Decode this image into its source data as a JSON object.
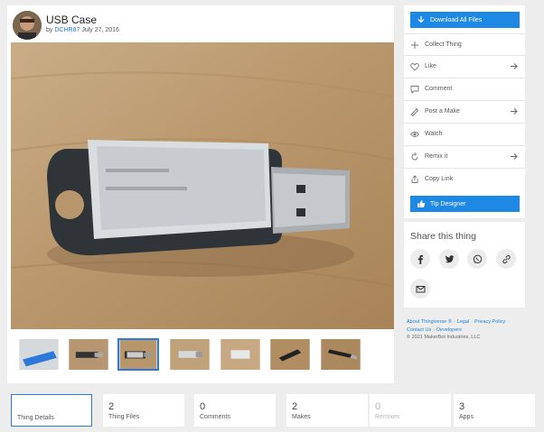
{
  "thing": {
    "title": "USB Case",
    "by": "by",
    "author": "DCHR87",
    "date": "July 27, 2016"
  },
  "actions": {
    "download": "Download All Files",
    "items": [
      {
        "label": "Collect Thing",
        "icon": "plus-icon",
        "arrow": false
      },
      {
        "label": "Like",
        "icon": "heart-icon",
        "arrow": true
      },
      {
        "label": "Comment",
        "icon": "comment-icon",
        "arrow": false
      },
      {
        "label": "Post a Make",
        "icon": "make-icon",
        "arrow": true
      },
      {
        "label": "Watch",
        "icon": "eye-icon",
        "arrow": false
      },
      {
        "label": "Remix it",
        "icon": "remix-icon",
        "arrow": true
      },
      {
        "label": "Copy Link",
        "icon": "link-copy-icon",
        "arrow": false
      }
    ],
    "tip": "Tip Designer"
  },
  "share": {
    "title": "Share this thing",
    "buttons": [
      "facebook-icon",
      "twitter-icon",
      "whatsapp-icon",
      "link-icon",
      "email-icon"
    ]
  },
  "footer": {
    "about": "About Thingiverse ®",
    "legal": "Legal",
    "privacy": "Privacy Policy",
    "contact": "Contact Us",
    "developers": "Developers",
    "copyright": "© 2021 MakerBot Industries, LLC"
  },
  "tabs": [
    {
      "num": "",
      "label": "Thing Details",
      "active": true,
      "disabled": false
    },
    {
      "num": "2",
      "label": "Thing Files",
      "active": false,
      "disabled": false
    },
    {
      "num": "0",
      "label": "Comments",
      "active": false,
      "disabled": false
    },
    {
      "num": "2",
      "label": "Makes",
      "active": false,
      "disabled": false
    },
    {
      "num": "0",
      "label": "Remixes",
      "active": false,
      "disabled": true
    },
    {
      "num": "3",
      "label": "Apps",
      "active": false,
      "disabled": false
    }
  ],
  "colors": {
    "accent": "#1e88e5",
    "link": "#1c7ed6",
    "background": "#ededed"
  }
}
